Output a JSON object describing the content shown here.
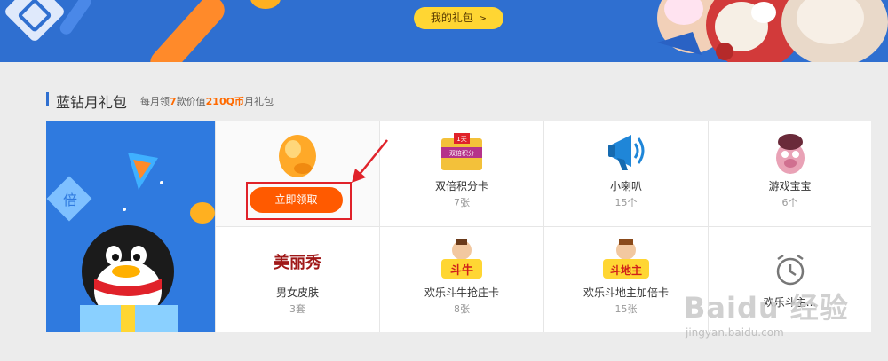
{
  "banner": {
    "gift_button_label": "我的礼包",
    "gift_button_icon": "chevron-right-icon",
    "accent_color": "#2f6fd0",
    "button_color": "#ffd633"
  },
  "section": {
    "title": "蓝钻月礼包",
    "subtitle_part1": "每月领",
    "subtitle_count": "7",
    "subtitle_part2": "款价值",
    "subtitle_value": "210Q币",
    "subtitle_part3": "月礼包"
  },
  "claim": {
    "button_label": "立即领取",
    "button_color": "#ff5a00",
    "icon": "golden-bean-icon"
  },
  "gifts": [
    {
      "name": "双倍积分卡",
      "count": "7张",
      "icon": "double-points-card-icon",
      "icon_text_top": "1天",
      "icon_text_bottom": "双倍积分"
    },
    {
      "name": "小喇叭",
      "count": "15个",
      "icon": "megaphone-icon"
    },
    {
      "name": "游戏宝宝",
      "count": "6个",
      "icon": "game-pet-icon"
    },
    {
      "name": "男女皮肤",
      "count": "3套",
      "icon": "skin-logo-icon",
      "icon_text": "美丽秀"
    },
    {
      "name": "欢乐斗牛抢庄卡",
      "count": "8张",
      "icon": "bullfight-card-icon",
      "icon_text": "斗牛"
    },
    {
      "name": "欢乐斗地主加倍卡",
      "count": "15张",
      "icon": "landlord-card-icon",
      "icon_text": "斗地主"
    },
    {
      "name": "欢乐斗主...",
      "count": "",
      "icon": "alarm-clock-icon"
    }
  ],
  "watermark": {
    "brand": "Baidu 经验",
    "url": "jingyan.baidu.com"
  }
}
